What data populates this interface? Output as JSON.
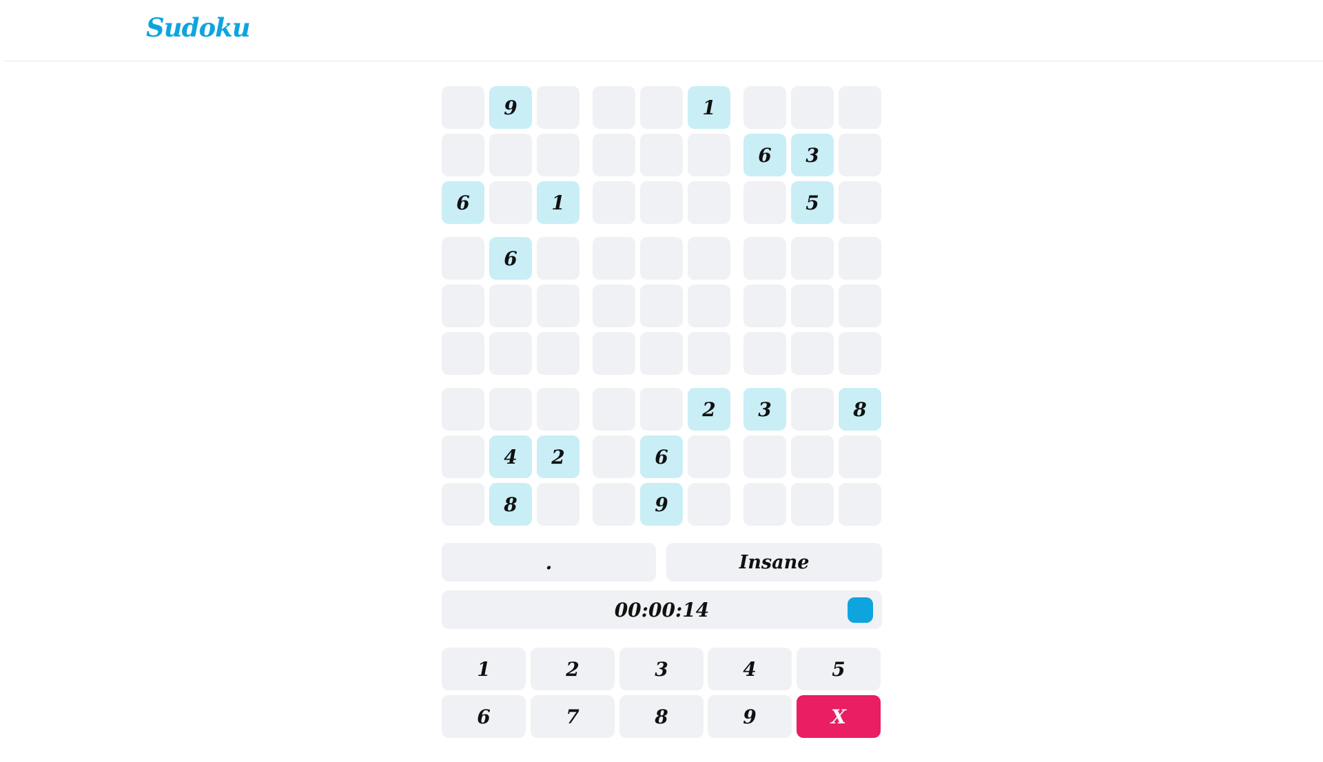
{
  "app": {
    "title": "Sudoku"
  },
  "colors": {
    "accent": "#0ea5df",
    "given_cell": "#c9eef6",
    "empty_cell": "#f0f1f4",
    "erase": "#e91e63"
  },
  "board": {
    "rows": [
      [
        "",
        "9",
        "",
        "",
        "",
        "1",
        "",
        "",
        ""
      ],
      [
        "",
        "",
        "",
        "",
        "",
        "",
        "6",
        "3",
        ""
      ],
      [
        "6",
        "",
        "1",
        "",
        "",
        "",
        "",
        "5",
        ""
      ],
      [
        "",
        "6",
        "",
        "",
        "",
        "",
        "",
        "",
        ""
      ],
      [
        "",
        "",
        "",
        "",
        "",
        "",
        "",
        "",
        ""
      ],
      [
        "",
        "",
        "",
        "",
        "",
        "",
        "",
        "",
        ""
      ],
      [
        "",
        "",
        "",
        "",
        "",
        "2",
        "3",
        "",
        "8"
      ],
      [
        "",
        "4",
        "2",
        "",
        "6",
        "",
        "",
        "",
        ""
      ],
      [
        "",
        "8",
        "",
        "",
        "9",
        "",
        "",
        "",
        ""
      ]
    ]
  },
  "status": {
    "left_value": ".",
    "difficulty": "Insane"
  },
  "timer": {
    "value": "00:00:14",
    "pause_icon": "pause-square-icon"
  },
  "keypad": {
    "keys": [
      "1",
      "2",
      "3",
      "4",
      "5",
      "6",
      "7",
      "8",
      "9",
      "X"
    ]
  }
}
